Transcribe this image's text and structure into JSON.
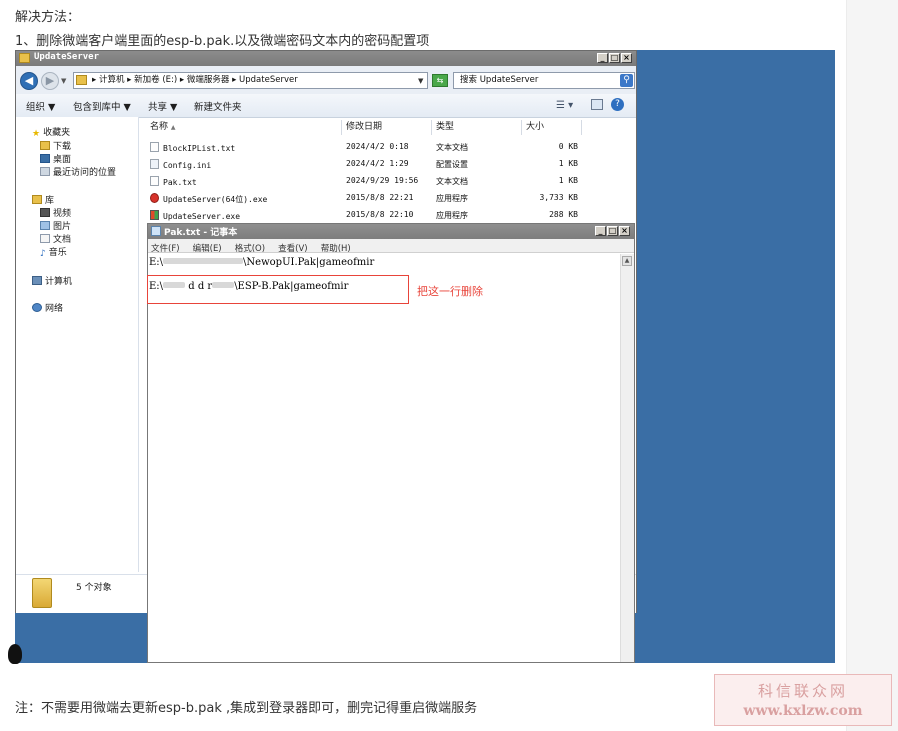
{
  "article": {
    "heading": "解决方法：",
    "step1": "1、删除微端客户端里面的esp-b.pak.以及微端密码文本内的密码配置项",
    "note": "注：不需要用微端去更新esp-b.pak ,集成到登录器即可，删完记得重启微端服务"
  },
  "explorer": {
    "title": "UpdateServer",
    "breadcrumb": "▸ 计算机 ▸ 新加卷 (E:) ▸ 微端服务器 ▸ UpdateServer",
    "search_placeholder": "搜索 UpdateServer",
    "toolbar": {
      "organize": "组织 ▼",
      "include_library": "包含到库中 ▼",
      "share": "共享 ▼",
      "new_folder": "新建文件夹"
    },
    "nav": {
      "favorites": "收藏夹",
      "downloads": "下载",
      "desktop": "桌面",
      "recent": "最近访问的位置",
      "libraries": "库",
      "videos": "视频",
      "pictures": "图片",
      "documents": "文档",
      "music": "音乐",
      "computer": "计算机",
      "network": "网络"
    },
    "columns": {
      "name": "名称",
      "modified": "修改日期",
      "type": "类型",
      "size": "大小"
    },
    "files": [
      {
        "name": "BlockIPList.txt",
        "modified": "2024/4/2 0:18",
        "type": "文本文档",
        "size": "0 KB",
        "icon": "text-file-icon"
      },
      {
        "name": "Config.ini",
        "modified": "2024/4/2 1:29",
        "type": "配置设置",
        "size": "1 KB",
        "icon": "config-file-icon"
      },
      {
        "name": "Pak.txt",
        "modified": "2024/9/29 19:56",
        "type": "文本文档",
        "size": "1 KB",
        "icon": "text-file-icon"
      },
      {
        "name": "UpdateServer(64位).exe",
        "modified": "2015/8/8 22:21",
        "type": "应用程序",
        "size": "3,733 KB",
        "icon": "app-red-icon"
      },
      {
        "name": "UpdateServer.exe",
        "modified": "2015/8/8 22:10",
        "type": "应用程序",
        "size": "288 KB",
        "icon": "app-color-icon"
      }
    ],
    "status_count": "5 个对象"
  },
  "notepad": {
    "title": "Pak.txt - 记事本",
    "menu": [
      "文件(F)",
      "编辑(E)",
      "格式(O)",
      "查看(V)",
      "帮助(H)"
    ],
    "line1_prefix": "E:\\",
    "line1_suffix": "\\NewopUI.Pak|gameofmir",
    "line2_prefix": "E:\\",
    "line2_mid": "d d r",
    "line2_suffix": "\\ESP-B.Pak|gameofmir"
  },
  "annotation": {
    "label": "把这一行删除",
    "color": "#e8443a"
  },
  "watermark": {
    "site_name": "科信联众网",
    "url": "www.kxlzw.com"
  }
}
